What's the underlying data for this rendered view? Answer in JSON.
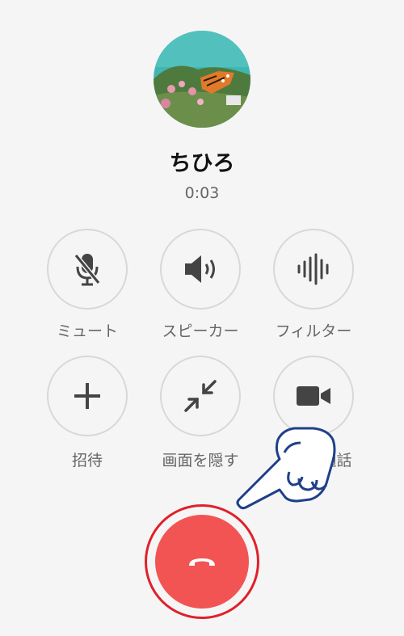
{
  "caller": {
    "name": "ちひろ",
    "duration": "0:03"
  },
  "controls": [
    {
      "label": "ミュート",
      "icon": "mic-off-icon"
    },
    {
      "label": "スピーカー",
      "icon": "speaker-icon"
    },
    {
      "label": "フィルター",
      "icon": "waveform-icon"
    },
    {
      "label": "招待",
      "icon": "plus-icon"
    },
    {
      "label": "画面を隠す",
      "icon": "minimize-icon"
    },
    {
      "label": "ビデオ通話",
      "icon": "video-camera-icon"
    }
  ],
  "colors": {
    "end_call": "#f25454",
    "highlight_ring": "#e0202a",
    "pointer_outline": "#1f3f8a"
  }
}
